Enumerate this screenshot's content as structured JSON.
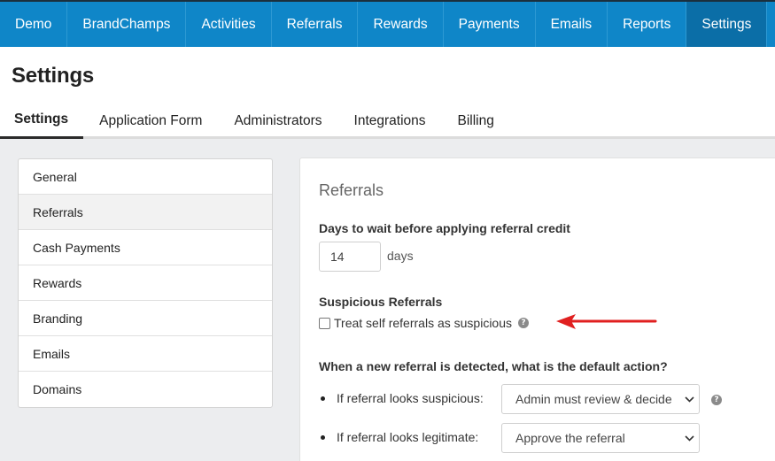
{
  "topnav": {
    "items": [
      "Demo",
      "BrandChamps",
      "Activities",
      "Referrals",
      "Rewards",
      "Payments",
      "Emails",
      "Reports",
      "Settings"
    ],
    "active": "Settings"
  },
  "page": {
    "title": "Settings"
  },
  "subtabs": {
    "items": [
      "Settings",
      "Application Form",
      "Administrators",
      "Integrations",
      "Billing"
    ],
    "active": "Settings"
  },
  "sidemenu": {
    "items": [
      "General",
      "Referrals",
      "Cash Payments",
      "Rewards",
      "Branding",
      "Emails",
      "Domains"
    ],
    "active": "Referrals"
  },
  "panel": {
    "title": "Referrals",
    "wait": {
      "label": "Days to wait before applying referral credit",
      "value": "14",
      "unit": "days"
    },
    "suspicious": {
      "heading": "Suspicious Referrals",
      "checkbox_label": "Treat self referrals as suspicious",
      "checked": false,
      "help_icon": "question-circle-icon",
      "arrow_color": "#e02020"
    },
    "default_action": {
      "question": "When a new referral is detected, what is the default action?",
      "suspicious_label": "If referral looks suspicious:",
      "suspicious_value": "Admin must review & decide",
      "legitimate_label": "If referral looks legitimate:",
      "legitimate_value": "Approve the referral"
    }
  },
  "colors": {
    "nav_bg": "#0f86c8",
    "nav_active": "#0b6ea7",
    "page_bg": "#ecedef"
  }
}
